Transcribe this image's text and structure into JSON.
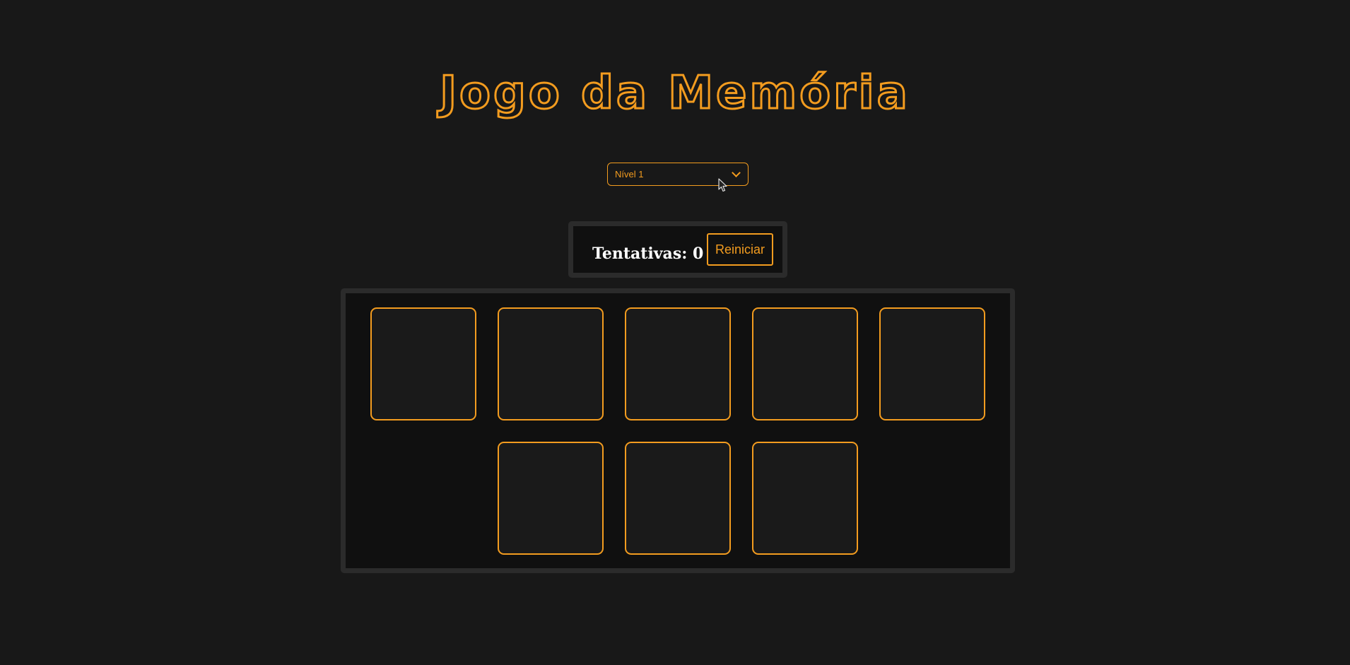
{
  "title": "Jogo da Memória",
  "level_select": {
    "selected": "Nível 1"
  },
  "status": {
    "attempts_label": "Tentativas:",
    "attempts_count": "0",
    "attempts_text": "Tentativas: 0",
    "restart_label": "Reiniciar"
  },
  "board": {
    "cards": [
      {
        "state": "face-down"
      },
      {
        "state": "face-down"
      },
      {
        "state": "face-down"
      },
      {
        "state": "face-down"
      },
      {
        "state": "face-down"
      },
      {
        "state": "face-down"
      },
      {
        "state": "face-down"
      },
      {
        "state": "face-down"
      }
    ]
  },
  "colors": {
    "background": "#181818",
    "accent": "#f39c1f",
    "panel": "#101010",
    "panel_border": "#2b2b2b",
    "text": "#ffffff"
  }
}
